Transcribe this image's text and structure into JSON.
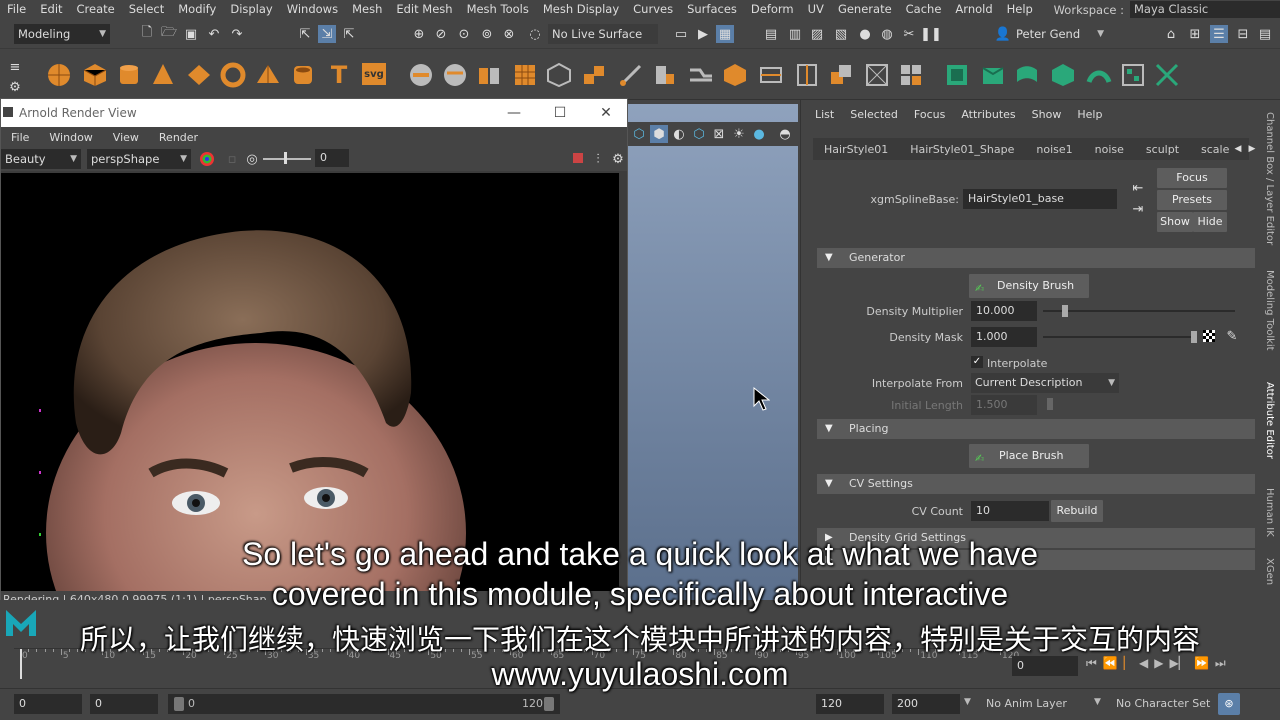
{
  "menubar": [
    "File",
    "Edit",
    "Create",
    "Select",
    "Modify",
    "Display",
    "Windows",
    "Mesh",
    "Edit Mesh",
    "Mesh Tools",
    "Mesh Display",
    "Curves",
    "Surfaces",
    "Deform",
    "UV",
    "Generate",
    "Cache",
    "Arnold",
    "Help"
  ],
  "workspace": {
    "label": "Workspace :",
    "value": "Maya Classic"
  },
  "statusline": {
    "mode": "Modeling",
    "live_surface": "No Live Surface",
    "user": "Peter Gend"
  },
  "arnold": {
    "title": "Arnold Render View",
    "menu": [
      "File",
      "Window",
      "View",
      "Render"
    ],
    "aov": "Beauty",
    "camera": "perspShape",
    "exposure": "0",
    "status": "Rendering | 640x480 0.99975 (1:1) | perspShap"
  },
  "ae": {
    "menu": [
      "List",
      "Selected",
      "Focus",
      "Attributes",
      "Show",
      "Help"
    ],
    "tabs": [
      "HairStyle01",
      "HairStyle01_Shape",
      "noise1",
      "noise",
      "sculpt",
      "scale"
    ],
    "spline_label": "xgmSplineBase:",
    "spline_value": "HairStyle01_base",
    "focus": "Focus",
    "presets": "Presets",
    "show": "Show",
    "hide": "Hide",
    "generator": "Generator",
    "density_brush": "Density Brush",
    "density_multiplier_label": "Density Multiplier",
    "density_multiplier": "10.000",
    "density_multiplier_level": 0.1,
    "density_mask_label": "Density Mask",
    "density_mask": "1.000",
    "density_mask_level": 1.0,
    "interpolate": "Interpolate",
    "interpolate_from_label": "Interpolate From",
    "interpolate_from": "Current Description",
    "initial_length_label": "Initial Length",
    "initial_length": "1.500",
    "placing": "Placing",
    "place_brush": "Place Brush",
    "cv_settings": "CV Settings",
    "cv_count_label": "CV Count",
    "cv_count": "10",
    "rebuild": "Rebuild",
    "density_grid": "Density Grid Settings"
  },
  "side_tabs": [
    "Channel Box / Layer Editor",
    "Modeling Toolkit",
    "Attribute Editor",
    "Human IK",
    "XGen"
  ],
  "timeline": {
    "ticks": [
      "0",
      "5",
      "10",
      "15",
      "20",
      "25",
      "30",
      "35",
      "40",
      "45",
      "50",
      "55",
      "60",
      "65",
      "70",
      "75",
      "80",
      "85",
      "90",
      "95",
      "100",
      "105",
      "110",
      "115",
      "120"
    ],
    "current_frame": "0"
  },
  "range": {
    "start": "0",
    "start2": "0",
    "slider_start": "0",
    "slider_end": "120",
    "end": "120",
    "end2": "200",
    "anim_layer": "No Anim Layer",
    "char_set": "No Character Set"
  },
  "subtitles": {
    "en1": "So let's go ahead and take a quick look at what we have",
    "en2": "covered in this module, specifically about interactive",
    "zh": "所以，让我们继续，快速浏览一下我们在这个模块中所讲述的内容，特别是关于交互的内容",
    "url": "www.yuyulaoshi.com"
  }
}
